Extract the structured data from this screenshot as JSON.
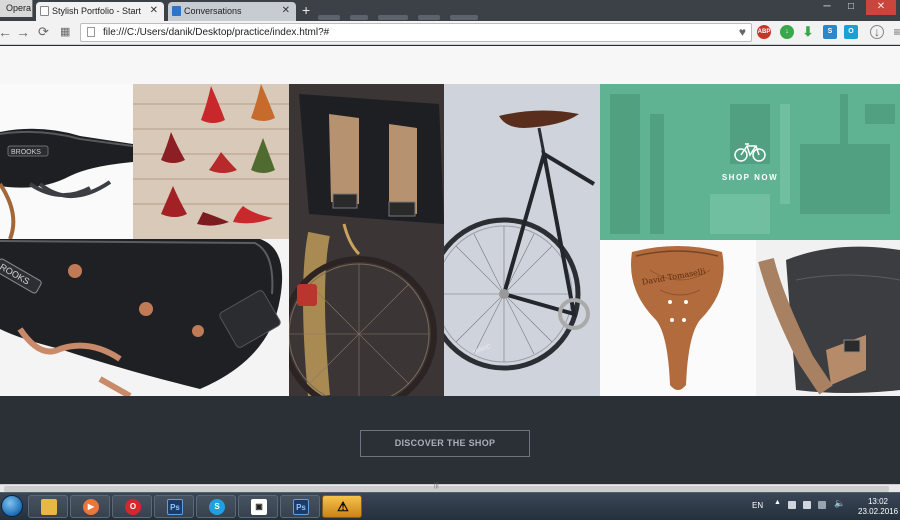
{
  "browser": {
    "menu_label": "Opera",
    "tabs": [
      {
        "label": "Stylish Portfolio - Start Bo",
        "active": true
      },
      {
        "label": "Conversations",
        "active": false
      }
    ],
    "new_tab": "+",
    "address": "file:///C:/Users/danik/Desktop/practice/index.html?#",
    "window_controls": {
      "minimize": "─",
      "maximize": "□",
      "close": "✕"
    },
    "extensions": [
      {
        "name": "adblock-icon",
        "text": "ABP",
        "color": "#c0392b"
      },
      {
        "name": "download-green-icon",
        "text": "",
        "color": "#3aa84a"
      },
      {
        "name": "download-arrow-icon",
        "text": "",
        "color": "#3aa84a"
      },
      {
        "name": "s-extension-icon",
        "text": "S",
        "color": "#2c86c9"
      },
      {
        "name": "o-extension-icon",
        "text": "O",
        "color": "#1a9fd6"
      },
      {
        "name": "download-manager-icon",
        "text": "",
        "color": "#777777"
      },
      {
        "name": "menu-icon",
        "text": "",
        "color": "#777777"
      }
    ]
  },
  "page": {
    "shop_now_label": "SHOP NOW",
    "discover_label": "DISCOVER THE SHOP",
    "colors": {
      "footer": "#2b3036",
      "shop_overlay": "#5cb191"
    }
  },
  "taskbar": {
    "apps": [
      {
        "name": "explorer-task",
        "icon": "folder-icon",
        "color": "#e8b844"
      },
      {
        "name": "media-player-task",
        "icon": "media-player-icon",
        "color": "#e9763a"
      },
      {
        "name": "opera-task",
        "icon": "opera-icon",
        "color": "#d6262f"
      },
      {
        "name": "photoshop-task",
        "icon": "photoshop-icon",
        "color": "#1d3b66",
        "text": "Ps"
      },
      {
        "name": "skype-task",
        "icon": "skype-icon",
        "color": "#1fa1e0",
        "text": "S"
      },
      {
        "name": "app-task",
        "icon": "app-window-icon",
        "color": "#ffffff"
      },
      {
        "name": "photoshop-task-2",
        "icon": "photoshop-icon",
        "color": "#1d3b66",
        "text": "Ps"
      },
      {
        "name": "warning-task",
        "icon": "warning-icon",
        "color": "#f0c030",
        "active": true
      }
    ],
    "language": "EN",
    "time": "13:02",
    "date": "23.02.2016"
  }
}
